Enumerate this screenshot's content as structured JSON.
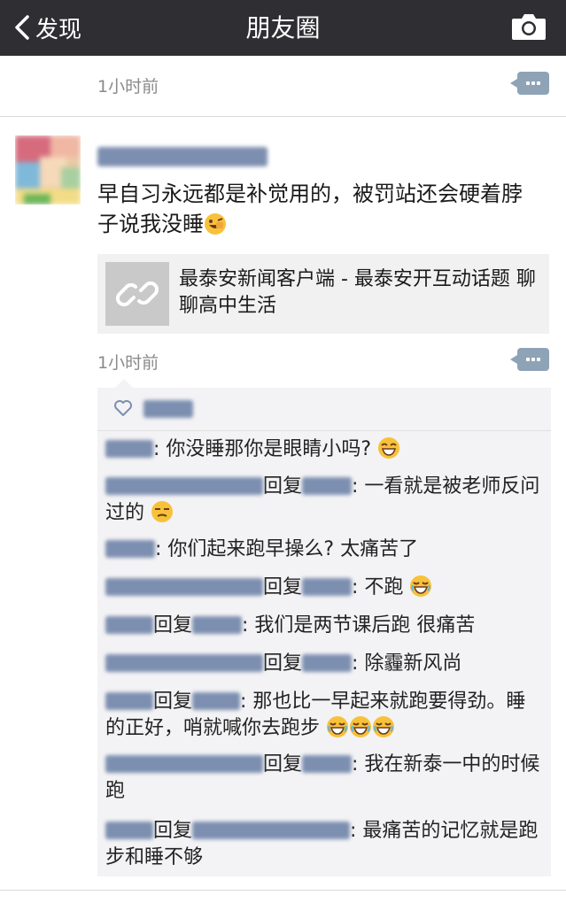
{
  "navbar": {
    "back_label": "发现",
    "title": "朋友圈"
  },
  "prev_post": {
    "time": "1小时前"
  },
  "post": {
    "text": "早自习永远都是补觉用的，被罚站还会硬着脖子说我没睡",
    "link": {
      "title": "最泰安新闻客户端 - 最泰安开互动话题 聊聊高中生活"
    },
    "time": "1小时前"
  },
  "comments": {
    "reply_word": "回复",
    "items": [
      {
        "text": ": 你没睡那你是眼睛小吗?"
      },
      {
        "text": ": 一看就是被老师反问过的"
      },
      {
        "text": ": 你们起来跑早操么? 太痛苦了"
      },
      {
        "text": ": 不跑"
      },
      {
        "text": ": 我们是两节课后跑 很痛苦"
      },
      {
        "text": ": 除霾新风尚"
      },
      {
        "text": ": 那也比一早起来就跑要得劲。睡的正好，哨就喊你去跑步"
      },
      {
        "text": ": 我在新泰一中的时候跑"
      },
      {
        "text": ": 最痛苦的记忆就是跑步和睡不够"
      }
    ]
  },
  "colors": {
    "navbar_bg": "#2e2e33",
    "name_blue": "#7d8fb0",
    "time_gray": "#8a8a8a",
    "panel_bg": "#f3f3f5",
    "more_btn": "#8fa3b7"
  },
  "icons": {
    "back": "chevron-left-icon",
    "camera": "camera-icon",
    "more": "comment-more-icon",
    "link": "link-icon",
    "like": "heart-icon",
    "emoji": "emoji-icon"
  }
}
